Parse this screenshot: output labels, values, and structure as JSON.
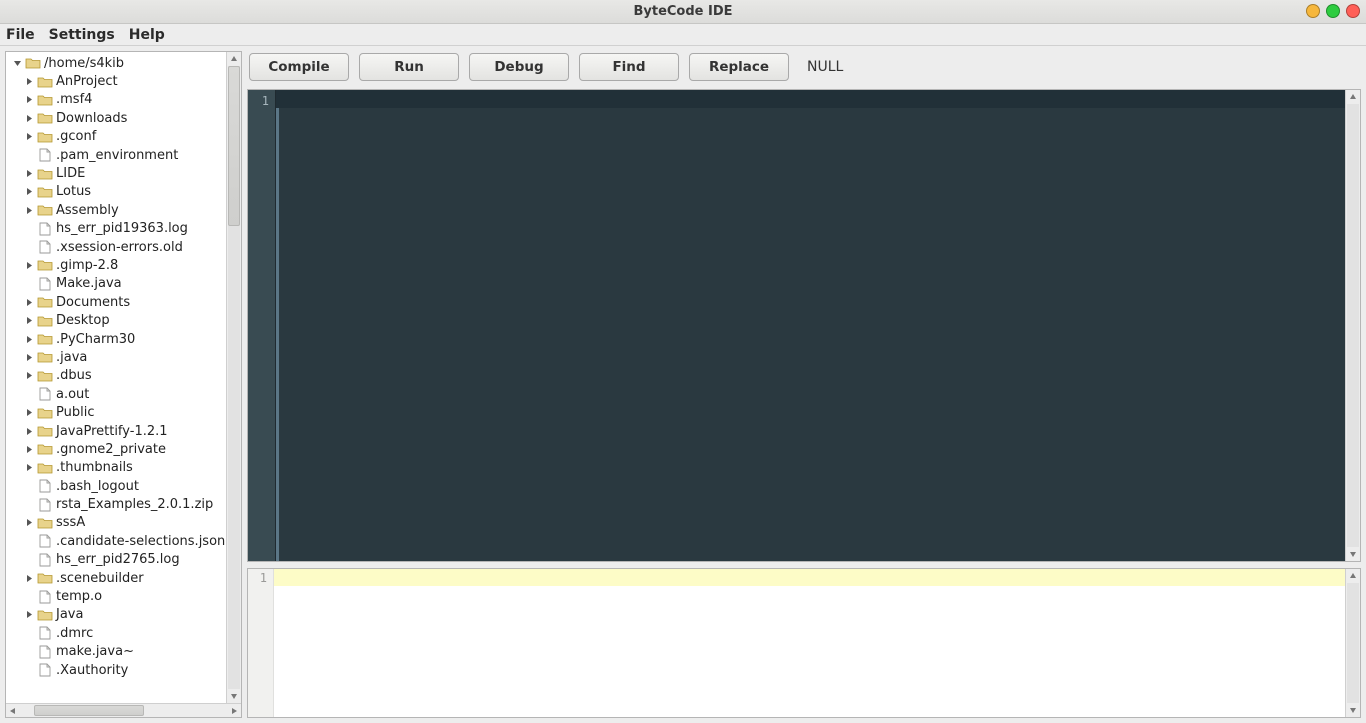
{
  "window": {
    "title": "ByteCode IDE"
  },
  "menu": {
    "file": "File",
    "settings": "Settings",
    "help": "Help"
  },
  "toolbar": {
    "compile": "Compile",
    "run": "Run",
    "debug": "Debug",
    "find": "Find",
    "replace": "Replace",
    "status": "NULL"
  },
  "tree": {
    "root": {
      "label": "/home/s4kib",
      "type": "folder",
      "expanded": true
    },
    "items": [
      {
        "label": "AnProject",
        "type": "folder",
        "expandable": true
      },
      {
        "label": ".msf4",
        "type": "folder",
        "expandable": true
      },
      {
        "label": "Downloads",
        "type": "folder",
        "expandable": true
      },
      {
        "label": ".gconf",
        "type": "folder",
        "expandable": true
      },
      {
        "label": ".pam_environment",
        "type": "file",
        "expandable": false
      },
      {
        "label": "LIDE",
        "type": "folder",
        "expandable": true
      },
      {
        "label": "Lotus",
        "type": "folder",
        "expandable": true
      },
      {
        "label": "Assembly",
        "type": "folder",
        "expandable": true
      },
      {
        "label": "hs_err_pid19363.log",
        "type": "file",
        "expandable": false
      },
      {
        "label": ".xsession-errors.old",
        "type": "file",
        "expandable": false
      },
      {
        "label": ".gimp-2.8",
        "type": "folder",
        "expandable": true
      },
      {
        "label": "Make.java",
        "type": "file",
        "expandable": false
      },
      {
        "label": "Documents",
        "type": "folder",
        "expandable": true
      },
      {
        "label": "Desktop",
        "type": "folder",
        "expandable": true
      },
      {
        "label": ".PyCharm30",
        "type": "folder",
        "expandable": true
      },
      {
        "label": ".java",
        "type": "folder",
        "expandable": true
      },
      {
        "label": ".dbus",
        "type": "folder",
        "expandable": true
      },
      {
        "label": "a.out",
        "type": "file",
        "expandable": false
      },
      {
        "label": "Public",
        "type": "folder",
        "expandable": true
      },
      {
        "label": "JavaPrettify-1.2.1",
        "type": "folder",
        "expandable": true
      },
      {
        "label": ".gnome2_private",
        "type": "folder",
        "expandable": true
      },
      {
        "label": ".thumbnails",
        "type": "folder",
        "expandable": true
      },
      {
        "label": ".bash_logout",
        "type": "file",
        "expandable": false
      },
      {
        "label": "rsta_Examples_2.0.1.zip",
        "type": "file",
        "expandable": false
      },
      {
        "label": "sssA",
        "type": "folder",
        "expandable": true
      },
      {
        "label": ".candidate-selections.json",
        "type": "file",
        "expandable": false
      },
      {
        "label": "hs_err_pid2765.log",
        "type": "file",
        "expandable": false
      },
      {
        "label": ".scenebuilder",
        "type": "folder",
        "expandable": true
      },
      {
        "label": "temp.o",
        "type": "file",
        "expandable": false
      },
      {
        "label": "Java",
        "type": "folder",
        "expandable": true
      },
      {
        "label": ".dmrc",
        "type": "file",
        "expandable": false
      },
      {
        "label": "make.java~",
        "type": "file",
        "expandable": false
      },
      {
        "label": ".Xauthority",
        "type": "file",
        "expandable": false
      }
    ]
  },
  "editor": {
    "gutter_start": "1"
  },
  "output": {
    "gutter_start": "1"
  }
}
